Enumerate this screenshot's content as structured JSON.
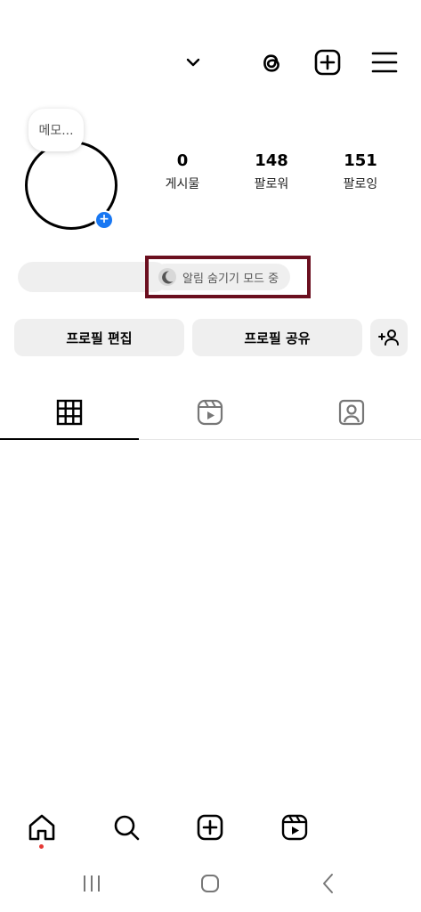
{
  "header": {
    "icons": [
      "chevron-down-icon",
      "threads-icon",
      "create-icon",
      "menu-icon"
    ]
  },
  "note": {
    "placeholder": "메모..."
  },
  "profile": {
    "avatar_badge": "+"
  },
  "stats": [
    {
      "value": "0",
      "label": "게시물"
    },
    {
      "value": "148",
      "label": "팔로워"
    },
    {
      "value": "151",
      "label": "팔로잉"
    }
  ],
  "status": {
    "quiet_mode_label": "알림 숨기기 모드 중",
    "highlight_color": "#6b0f1f"
  },
  "actions": {
    "edit_profile": "프로필 편집",
    "share_profile": "프로필 공유",
    "add_person": "+"
  },
  "tabs": [
    "grid-icon",
    "reels-icon",
    "tagged-icon"
  ],
  "bottom_nav": [
    "home-icon",
    "search-icon",
    "create-icon",
    "reels-icon"
  ],
  "colors": {
    "accent_blue": "#1877f2",
    "notification_dot": "#e53935",
    "button_bg": "#efefef"
  }
}
